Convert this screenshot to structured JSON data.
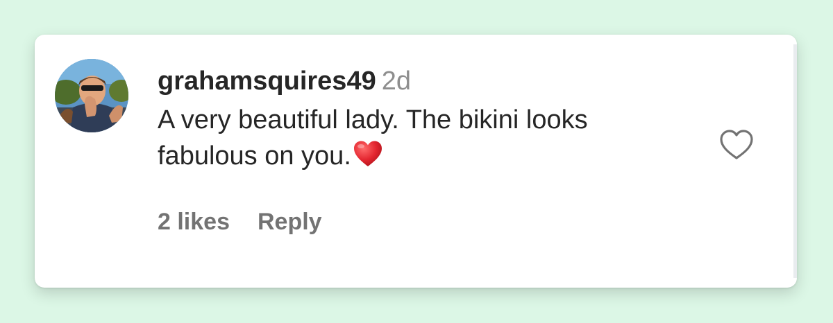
{
  "comment": {
    "username": "grahamsquires49",
    "time_ago": "2d",
    "text": "A very beautiful lady. The bikini looks fabulous on you.",
    "likes": "2 likes",
    "reply_label": "Reply"
  },
  "icons": {
    "like": "heart-outline-icon",
    "emoji": "red-heart-emoji",
    "avatar": "avatar"
  },
  "colors": {
    "background": "#dcf7e6",
    "card": "#ffffff",
    "username": "#262626",
    "muted": "#8e8e8e",
    "action": "#737373",
    "emoji_heart": "#e3252f"
  }
}
